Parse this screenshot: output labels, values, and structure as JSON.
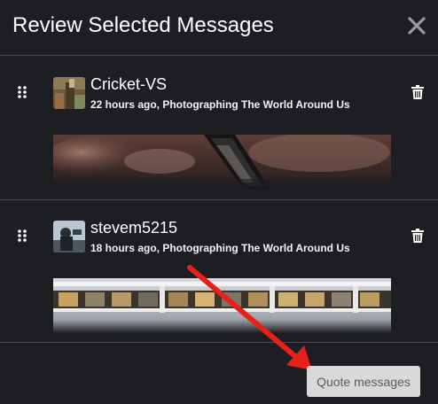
{
  "dialog": {
    "title": "Review Selected Messages",
    "close_icon": "close-icon"
  },
  "messages": [
    {
      "username": "Cricket-VS",
      "meta": "22 hours ago, Photographing The World Around Us",
      "drag_icon": "drag-handle-icon",
      "delete_icon": "trash-icon"
    },
    {
      "username": "stevem5215",
      "meta": "18 hours ago, Photographing The World Around Us",
      "drag_icon": "drag-handle-icon",
      "delete_icon": "trash-icon"
    }
  ],
  "footer": {
    "quote_label": "Quote messages"
  },
  "colors": {
    "background": "#1d1e21",
    "divider": "#4a4b4e",
    "button_bg": "#d9d9d9",
    "button_text": "#5b5b5b",
    "annotation_arrow": "#e8201a"
  }
}
